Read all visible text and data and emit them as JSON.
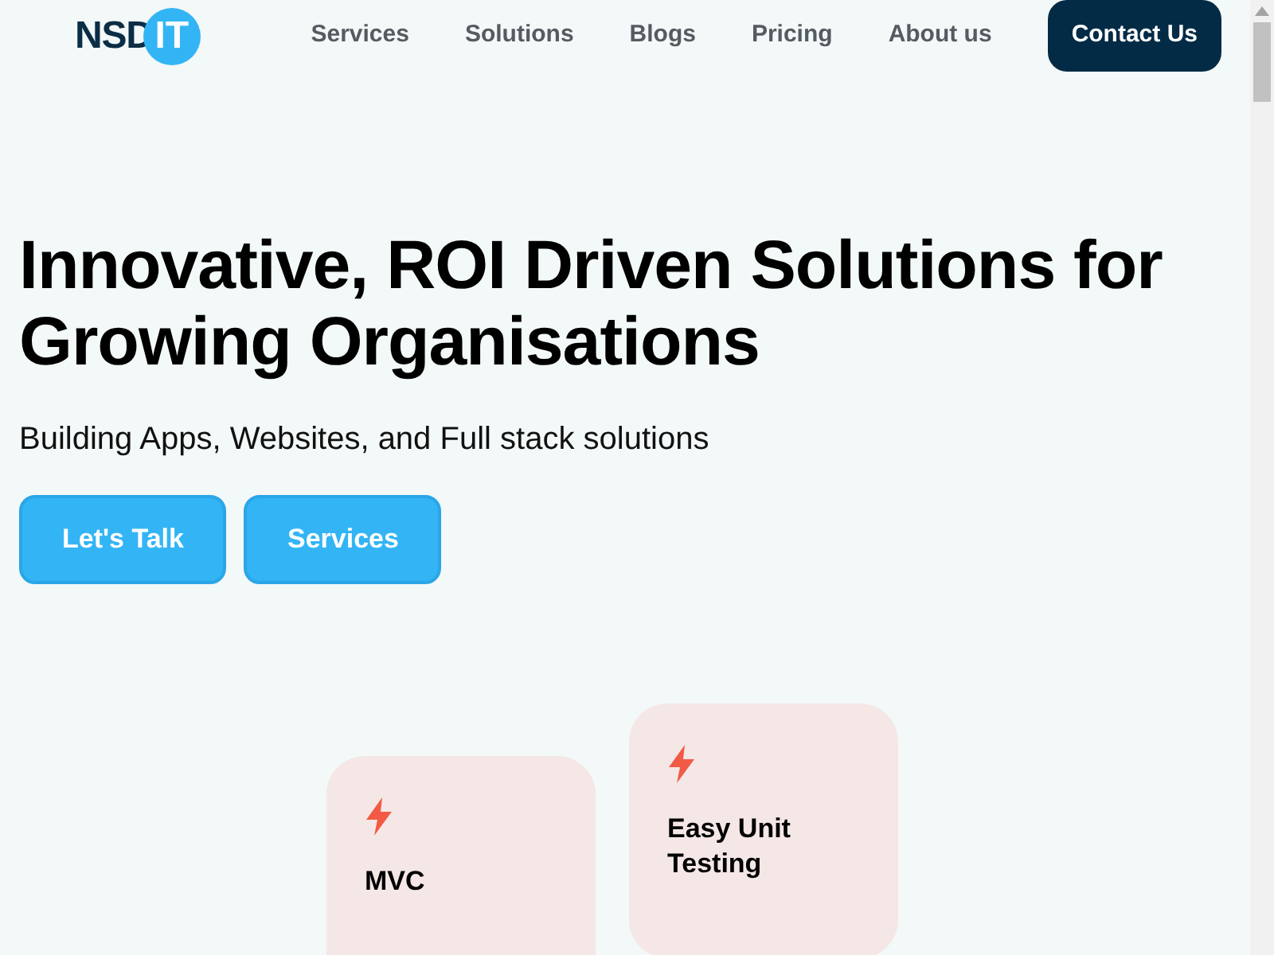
{
  "logo": {
    "dark_part": "NSD",
    "circle_part": "IT"
  },
  "nav": {
    "links": [
      "Services",
      "Solutions",
      "Blogs",
      "Pricing",
      "About us"
    ],
    "cta": "Contact Us"
  },
  "hero": {
    "title": "Innovative, ROI Driven Solutions for Growing Organisations",
    "subtitle": "Building Apps, Websites, and Full stack solutions",
    "buttons": [
      "Let's Talk",
      "Services"
    ]
  },
  "features": [
    {
      "title": "MVC"
    },
    {
      "title": "Easy Unit Testing"
    }
  ]
}
